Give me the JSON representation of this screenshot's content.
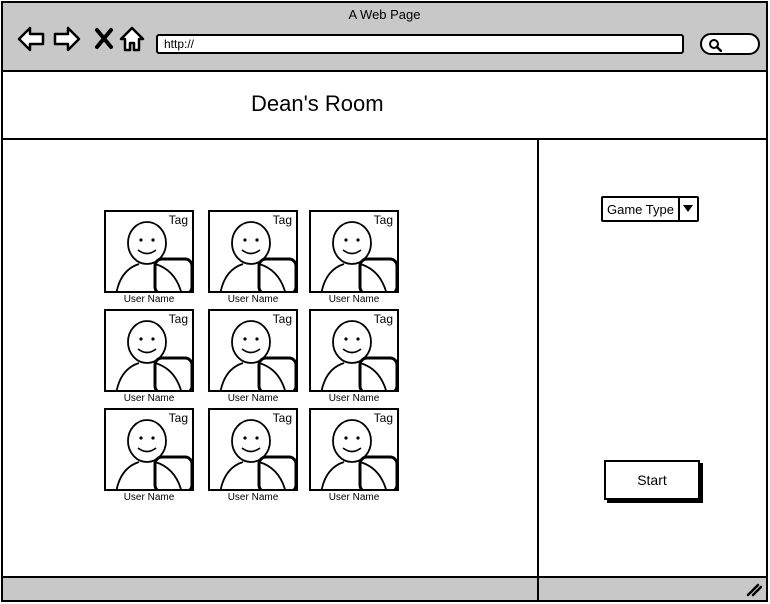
{
  "window": {
    "title": "A Web Page"
  },
  "toolbar": {
    "url": "http://",
    "icons": [
      "back-arrow-icon",
      "forward-arrow-icon",
      "close-x-icon",
      "home-icon",
      "search-icon"
    ]
  },
  "header": {
    "title": "Dean's Room"
  },
  "users": [
    {
      "tag": "Tag",
      "name": "User Name"
    },
    {
      "tag": "Tag",
      "name": "User Name"
    },
    {
      "tag": "Tag",
      "name": "User Name"
    },
    {
      "tag": "Tag",
      "name": "User Name"
    },
    {
      "tag": "Tag",
      "name": "User Name"
    },
    {
      "tag": "Tag",
      "name": "User Name"
    },
    {
      "tag": "Tag",
      "name": "User Name"
    },
    {
      "tag": "Tag",
      "name": "User Name"
    },
    {
      "tag": "Tag",
      "name": "User Name"
    }
  ],
  "sidebar": {
    "game_type": {
      "selected": "Game Type"
    },
    "start_label": "Start"
  },
  "colors": {
    "chrome": "#c8c8c8",
    "background": "#ffffff",
    "stroke": "#000000"
  }
}
